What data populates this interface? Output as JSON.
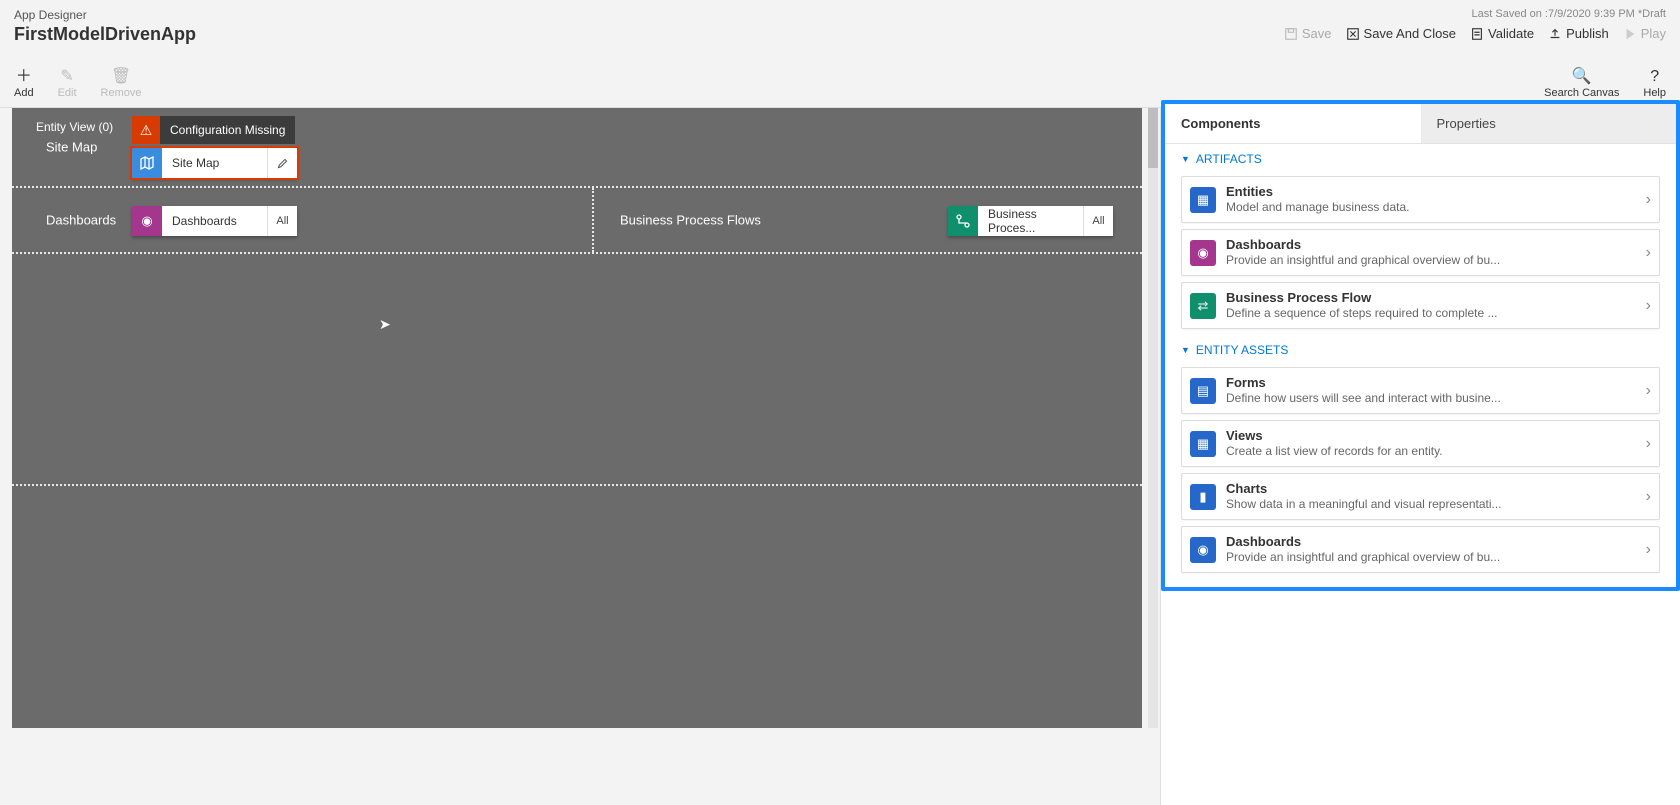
{
  "header": {
    "title": "App Designer",
    "app_name": "FirstModelDrivenApp",
    "last_saved": "Last Saved on :7/9/2020 9:39 PM *Draft",
    "actions": {
      "save": "Save",
      "save_close": "Save And Close",
      "validate": "Validate",
      "publish": "Publish",
      "play": "Play"
    }
  },
  "toolbar": {
    "add": "Add",
    "edit": "Edit",
    "remove": "Remove",
    "search": "Search Canvas",
    "help": "Help"
  },
  "canvas": {
    "sitemap_label": "Site Map",
    "warning": "Configuration Missing",
    "sitemap_tile": "Site Map",
    "dashboards_label": "Dashboards",
    "dashboards_tile": "Dashboards",
    "dashboards_all": "All",
    "bpf_label": "Business Process Flows",
    "bpf_tile": "Business Proces...",
    "bpf_all": "All",
    "entity_view": "Entity View (0)"
  },
  "side": {
    "tabs": {
      "components": "Components",
      "properties": "Properties"
    },
    "sections": {
      "artifacts": "ARTIFACTS",
      "entity_assets": "ENTITY ASSETS"
    },
    "artifacts": [
      {
        "title": "Entities",
        "desc": "Model and manage business data."
      },
      {
        "title": "Dashboards",
        "desc": "Provide an insightful and graphical overview of bu..."
      },
      {
        "title": "Business Process Flow",
        "desc": "Define a sequence of steps required to complete ..."
      }
    ],
    "entity_assets": [
      {
        "title": "Forms",
        "desc": "Define how users will see and interact with busine..."
      },
      {
        "title": "Views",
        "desc": "Create a list view of records for an entity."
      },
      {
        "title": "Charts",
        "desc": "Show data in a meaningful and visual representati..."
      },
      {
        "title": "Dashboards",
        "desc": "Provide an insightful and graphical overview of bu..."
      }
    ]
  }
}
